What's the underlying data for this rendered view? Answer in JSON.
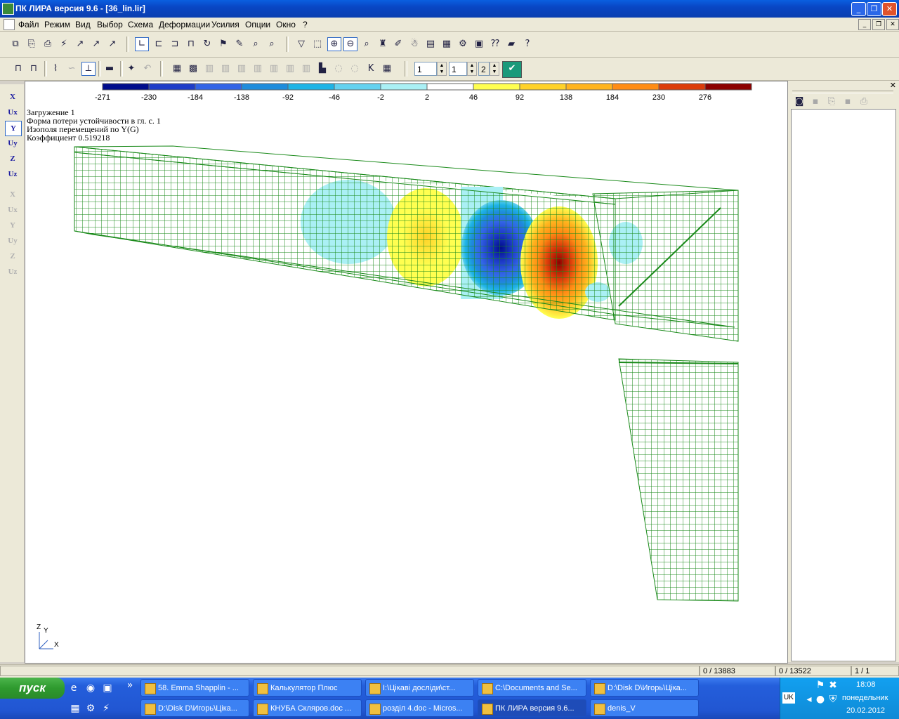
{
  "window": {
    "title": "ПК ЛИРА  версия 9.6 - [36_lin.lir]"
  },
  "menu": [
    "Файл",
    "Режим",
    "Вид",
    "Выбор",
    "Схема",
    "Деформации",
    "Усилия",
    "Опции",
    "Окно",
    "?"
  ],
  "toolbar": {
    "spin1": "1",
    "spin2": "1",
    "spin3": "2"
  },
  "left_toolbar": [
    "X",
    "Ux",
    "Y",
    "Uy",
    "Z",
    "Uz",
    "X",
    "Ux",
    "Y",
    "Uy",
    "Z",
    "Uz"
  ],
  "scale": {
    "labels": [
      "-271",
      "-230",
      "-184",
      "-138",
      "-92",
      "-46",
      "-2",
      "2",
      "46",
      "92",
      "138",
      "184",
      "230",
      "276"
    ],
    "colors": [
      "#000c8c",
      "#1e3cc8",
      "#3264e6",
      "#1e8cdc",
      "#1eb4e6",
      "#64d2f0",
      "#aaf0f5",
      "#ffffff",
      "#ffff50",
      "#ffd228",
      "#ffb41e",
      "#ff8c14",
      "#dc3c0a",
      "#8c0000"
    ]
  },
  "info": {
    "line1": "Загружение  1",
    "line2": "Форма потери устойчивости в гл. с.  1",
    "line3": "Изополя перемещений по Y(G)",
    "line4": "Коэффициент   0.519218"
  },
  "axes": {
    "z": "Z",
    "y": "Y",
    "x": "X"
  },
  "status": {
    "nodes": "0 / 13883",
    "elements": "0 / 13522",
    "page": "1 / 1"
  },
  "taskbar": {
    "start": "пуск",
    "row1": [
      "58. Emma Shapplin - ...",
      "Калькулятор Плюс",
      "I:\\Цікаві досліди\\ст...",
      "C:\\Documents and Se...",
      "D:\\Disk D\\Игорь\\Цікa..."
    ],
    "row2": [
      "D:\\Disk D\\Игорь\\Цікa...",
      "КНУБА Скляров.doc ...",
      "розділ 4.doc - Micros...",
      "ПК ЛИРА  версия 9.6...",
      "denis_V"
    ],
    "lang": "UK",
    "time": "18:08",
    "day": "понедельник",
    "date": "20.02.2012"
  }
}
